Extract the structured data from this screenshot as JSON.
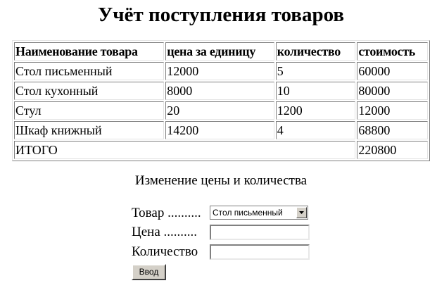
{
  "page": {
    "title": "Учёт поступления товаров"
  },
  "table": {
    "headers": [
      "Наименование товара",
      "цена за единицу",
      "количество",
      "стоимость"
    ],
    "rows": [
      [
        "Стол письменный",
        "12000",
        "5",
        "60000"
      ],
      [
        "Стол кухонный",
        "8000",
        "10",
        "80000"
      ],
      [
        "Стул",
        "20",
        "1200",
        "12000"
      ],
      [
        "Шкаф книжный",
        "14200",
        "4",
        "68800"
      ]
    ],
    "total_label": "ИТОГО",
    "total_value": "220800"
  },
  "form": {
    "section_title": "Изменение цены и количества",
    "product_label": "Товар ..........",
    "product_selected": "Стол письменный",
    "price_label": "Цена ..........",
    "price_value": "",
    "quantity_label": "Количество",
    "quantity_value": "",
    "submit_label": "Ввод"
  },
  "colors": {
    "button_face": "#d4d0c8",
    "border_dark": "#808080",
    "border_light": "#e4e4e4"
  }
}
